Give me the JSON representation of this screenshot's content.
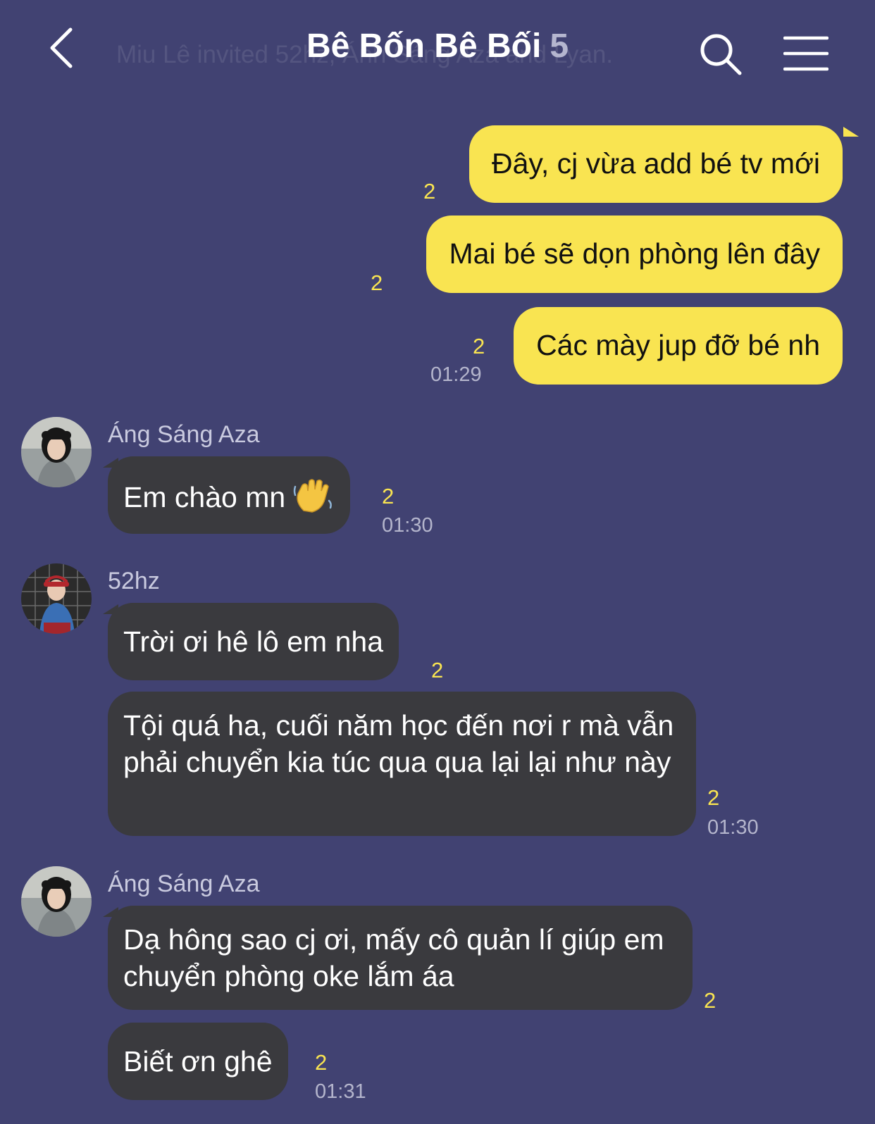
{
  "header": {
    "title": "Bê Bốn Bê Bối",
    "member_count": "5",
    "ghost_notice": "Miu Lê invited 52hz, Ánh Sáng Aza and Lyan."
  },
  "messages": {
    "m1": {
      "text": "Đây, cj vừa add bé tv mới",
      "read": "2"
    },
    "m2": {
      "text": "Mai bé sẽ dọn phòng lên đây",
      "read": "2"
    },
    "m3": {
      "text": "Các mày jup đỡ bé nh",
      "read": "2",
      "time": "01:29"
    },
    "g1": {
      "sender": "Áng Sáng Aza",
      "text": "Em chào mn",
      "emoji": "waving-hand-emoji",
      "read": "2",
      "time": "01:30"
    },
    "g2": {
      "sender": "52hz",
      "text": "Trời ơi hê lô em nha",
      "read": "2"
    },
    "g3": {
      "text": "Tội quá ha, cuối năm học đến nơi r mà vẫn phải chuyển kia túc qua qua lại lại như này",
      "read": "2",
      "time": "01:30"
    },
    "g4": {
      "sender": "Áng Sáng Aza",
      "text": "Dạ hông sao cj ơi, mấy cô quản lí giúp em chuyển phòng oke lắm áa",
      "read": "2"
    },
    "g5": {
      "text": "Biết ơn ghê",
      "read": "2",
      "time": "01:31"
    }
  },
  "colors": {
    "background": "#414272",
    "outgoing_bubble": "#f9e451",
    "incoming_bubble": "#3a3a3e",
    "read_count": "#f9e451",
    "timestamp": "#b4b5cc"
  },
  "icons": {
    "back": "chevron-left-icon",
    "search": "search-icon",
    "menu": "hamburger-menu-icon"
  }
}
